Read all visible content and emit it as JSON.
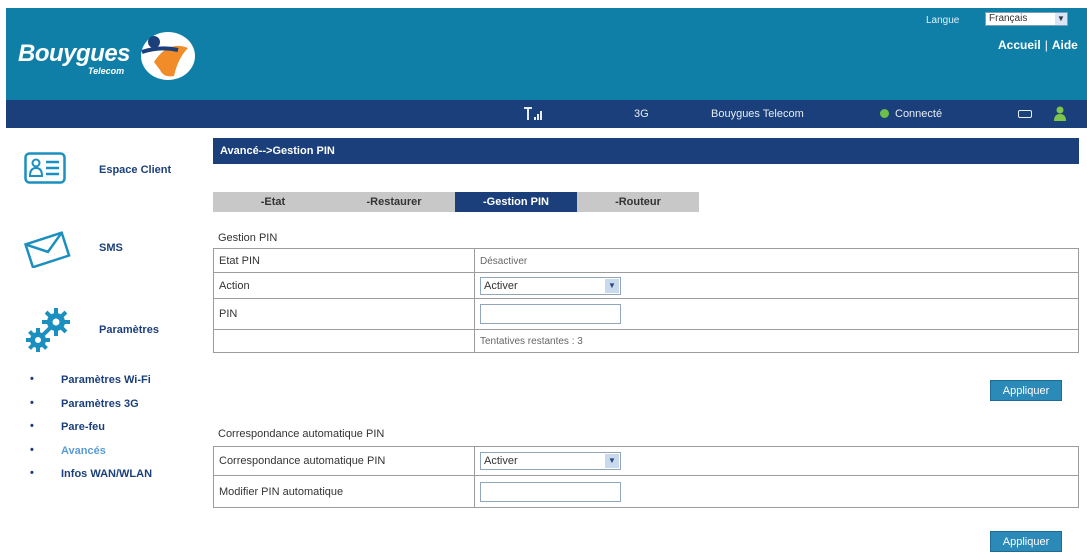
{
  "brand": {
    "name": "Bouygues",
    "sub": "Telecom"
  },
  "header": {
    "language_label": "Langue",
    "language_value": "Français",
    "link_home": "Accueil",
    "link_separator": "|",
    "link_help": "Aide"
  },
  "status": {
    "network_type": "3G",
    "operator": "Bouygues Telecom",
    "connection": "Connecté",
    "connection_color": "#6cc04a"
  },
  "sidebar": {
    "client": "Espace Client",
    "sms": "SMS",
    "settings": "Paramètres",
    "items": [
      {
        "label": "Paramètres Wi-Fi"
      },
      {
        "label": "Paramètres 3G"
      },
      {
        "label": "Pare-feu"
      },
      {
        "label": "Avancés"
      },
      {
        "label": "Infos WAN/WLAN"
      }
    ],
    "active_item": "Avancés"
  },
  "main": {
    "title": "Avancé-->Gestion PIN",
    "tabs": [
      {
        "label": "-Etat"
      },
      {
        "label": "-Restaurer"
      },
      {
        "label": "-Gestion PIN"
      },
      {
        "label": "-Routeur"
      }
    ],
    "active_tab": "-Gestion PIN",
    "pin_section": {
      "title": "Gestion PIN",
      "state_label": "Etat PIN",
      "state_value": "Désactiver",
      "action_label": "Action",
      "action_value": "Activer",
      "pin_label": "PIN",
      "pin_value": "",
      "attempts_text": "Tentatives restantes : 3"
    },
    "auto_section": {
      "title": "Correspondance automatique PIN",
      "match_label": "Correspondance automatique PIN",
      "match_value": "Activer",
      "modify_label": "Modifier PIN automatique",
      "modify_value": ""
    },
    "apply_label": "Appliquer"
  },
  "colors": {
    "header_bg": "#0f7fa8",
    "nav_bg": "#1b3f7a",
    "button_bg": "#2b8ab8",
    "active_link": "#5b9bd5"
  },
  "icons": [
    "bouygues-logo-icon",
    "signal-icon",
    "status-dot-icon",
    "battery-icon",
    "user-icon",
    "client-card-icon",
    "sms-envelope-icon",
    "gears-icon",
    "chevron-down-icon"
  ]
}
